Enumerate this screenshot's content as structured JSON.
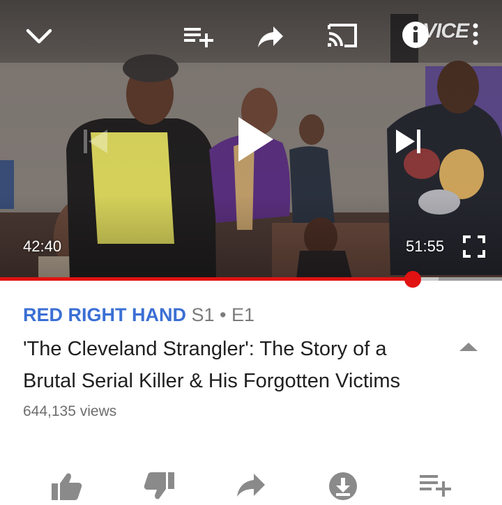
{
  "player": {
    "watermark": "VICE",
    "time_current": "42:40",
    "time_duration": "51:55",
    "progress_fraction": 0.822,
    "buffered_fraction": 0.873,
    "progress_color": "#e11212",
    "icons": {
      "top": [
        "chevron-down-icon",
        "add-to-queue-icon",
        "share-icon",
        "cast-icon",
        "info-icon",
        "more-vert-icon"
      ],
      "center": [
        "previous-icon",
        "play-icon",
        "next-icon"
      ],
      "bottom": [
        "fullscreen-icon"
      ]
    }
  },
  "video": {
    "series_name": "RED RIGHT HAND",
    "episode": "S1 • E1",
    "title": "'The Cleveland Strangler': The Story of a Brutal Serial Killer & His Forgotten Victims",
    "views": "644,135 views",
    "series_color": "#3b6fd4"
  },
  "actions": {
    "icons": [
      "thumbs-up-icon",
      "thumbs-down-icon",
      "share-icon",
      "download-icon",
      "add-to-playlist-icon"
    ]
  }
}
